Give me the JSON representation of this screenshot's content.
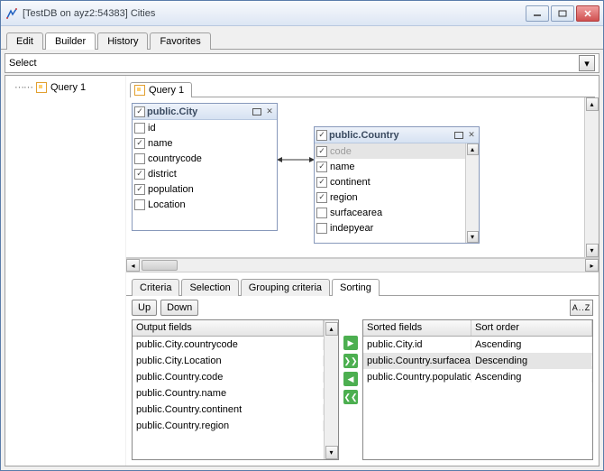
{
  "window": {
    "title": "[TestDB on ayz2:54383] Cities"
  },
  "main_tabs": {
    "edit": "Edit",
    "builder": "Builder",
    "history": "History",
    "favorites": "Favorites"
  },
  "select_label": "Select",
  "tree": {
    "query1": "Query 1"
  },
  "query_tab": "Query 1",
  "tables": {
    "city": {
      "title": "public.City",
      "fields": {
        "id": "id",
        "name": "name",
        "countrycode": "countrycode",
        "district": "district",
        "population": "population",
        "location": "Location"
      }
    },
    "country": {
      "title": "public.Country",
      "fields": {
        "code": "code",
        "name": "name",
        "continent": "continent",
        "region": "region",
        "surfacearea": "surfacearea",
        "indepyear": "indepyear"
      }
    }
  },
  "bottom_tabs": {
    "criteria": "Criteria",
    "selection": "Selection",
    "grouping": "Grouping criteria",
    "sorting": "Sorting"
  },
  "sort_buttons": {
    "up": "Up",
    "down": "Down",
    "az": "A..Z"
  },
  "output_header": "Output fields",
  "sorted_header": "Sorted fields",
  "order_header": "Sort order",
  "output_fields": [
    "public.City.countrycode",
    "public.City.Location",
    "public.Country.code",
    "public.Country.name",
    "public.Country.continent",
    "public.Country.region"
  ],
  "sorted_fields": [
    {
      "field": "public.City.id",
      "order": "Ascending"
    },
    {
      "field": "public.Country.surfacearea",
      "order": "Descending"
    },
    {
      "field": "public.Country.population",
      "order": "Ascending"
    }
  ]
}
